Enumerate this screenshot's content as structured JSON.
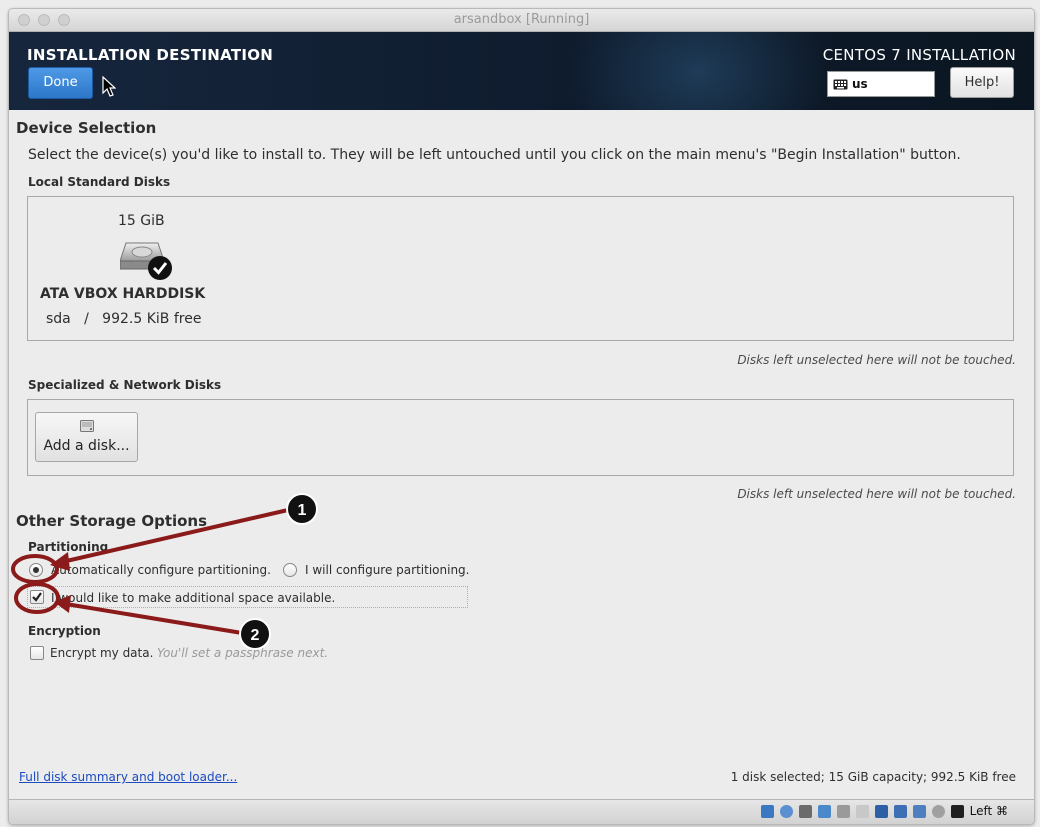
{
  "window": {
    "title": "arsandbox [Running]"
  },
  "header": {
    "title": "INSTALLATION DESTINATION",
    "done_label": "Done",
    "product": "CENTOS 7 INSTALLATION",
    "keyboard_layout": "us",
    "help_label": "Help!"
  },
  "device_selection": {
    "title": "Device Selection",
    "instructions": "Select the device(s) you'd like to install to.  They will be left untouched until you click on the main menu's \"Begin Installation\" button.",
    "local_title": "Local Standard Disks",
    "disk": {
      "size": "15 GiB",
      "name": "ATA VBOX HARDDISK",
      "info": "sda   /   992.5 KiB free",
      "selected": true
    },
    "local_note": "Disks left unselected here will not be touched.",
    "specialized_title": "Specialized & Network Disks",
    "add_disk_label": "Add a disk...",
    "specialized_note": "Disks left unselected here will not be touched."
  },
  "storage": {
    "title": "Other Storage Options",
    "partitioning_title": "Partitioning",
    "auto_label": "Automatically configure partitioning.",
    "manual_label": "I will configure partitioning.",
    "selected": "auto",
    "additional_space_label": "I would like to make additional space available.",
    "additional_space_checked": true,
    "encryption_title": "Encryption",
    "encrypt_label": "Encrypt my data.",
    "encrypt_hint": "You'll set a passphrase next.",
    "encrypt_checked": false
  },
  "footer": {
    "summary_link": "Full disk summary and boot loader...",
    "summary": "1 disk selected; 15 GiB capacity; 992.5 KiB free"
  },
  "statusbar": {
    "host_key": "Left ⌘"
  },
  "annotations": {
    "callout_1": "1",
    "callout_2": "2",
    "color": "#8b1a1a"
  }
}
